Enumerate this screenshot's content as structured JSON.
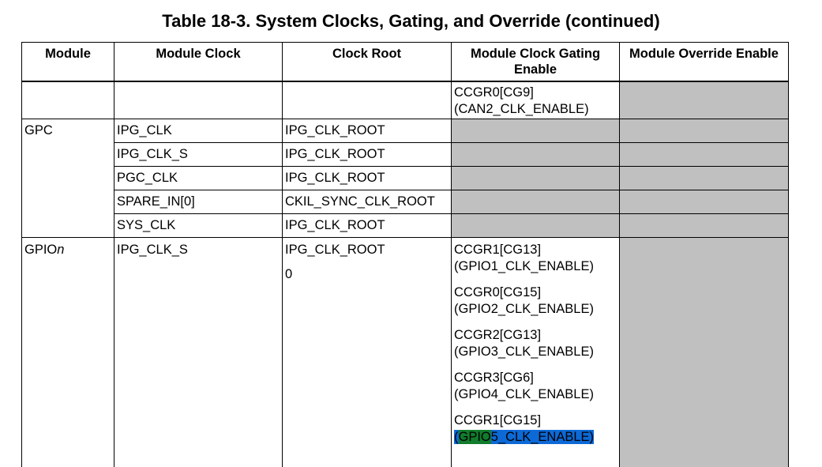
{
  "title": "Table 18-3.   System Clocks, Gating, and Override (continued)",
  "headers": {
    "module": "Module",
    "module_clock": "Module Clock",
    "clock_root": "Clock Root",
    "gating": "Module Clock Gating Enable",
    "override": "Module Override Enable"
  },
  "row_can2": {
    "gating_1": "CCGR0[CG9]",
    "gating_2": "(CAN2_CLK_ENABLE)"
  },
  "gpc": {
    "module": "GPC",
    "rows": [
      {
        "clock": "IPG_CLK",
        "root": "IPG_CLK_ROOT"
      },
      {
        "clock": "IPG_CLK_S",
        "root": "IPG_CLK_ROOT"
      },
      {
        "clock": "PGC_CLK",
        "root": "IPG_CLK_ROOT"
      },
      {
        "clock": "SPARE_IN[0]",
        "root": "CKIL_SYNC_CLK_ROOT"
      },
      {
        "clock": "SYS_CLK",
        "root": "IPG_CLK_ROOT"
      }
    ]
  },
  "gpio": {
    "module_prefix": "GPIO",
    "module_suffix": "n",
    "clock": "IPG_CLK_S",
    "root": "IPG_CLK_ROOT",
    "root_extra": "0",
    "gating": [
      {
        "reg": "CCGR1[CG13]",
        "enable": "(GPIO1_CLK_ENABLE)"
      },
      {
        "reg": "CCGR0[CG15]",
        "enable": "(GPIO2_CLK_ENABLE)"
      },
      {
        "reg": "CCGR2[CG13]",
        "enable": "(GPIO3_CLK_ENABLE)"
      },
      {
        "reg": "CCGR3[CG6]",
        "enable": "(GPIO4_CLK_ENABLE)"
      },
      {
        "reg": "CCGR1[CG15]",
        "enable_open": "(",
        "enable_green": "GPIO",
        "enable_rest": "5_CLK_ENABLE)"
      }
    ]
  },
  "colors": {
    "shade": "#c0c0c0",
    "highlight_green": "#107c2c",
    "highlight_blue": "#0d69d6"
  }
}
